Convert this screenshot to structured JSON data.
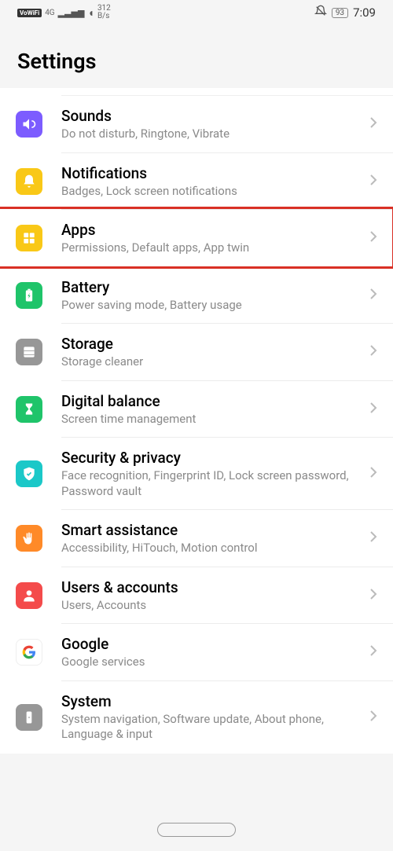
{
  "status": {
    "vowifi": "VoWiFi",
    "net": "4G",
    "speed_top": "312",
    "speed_bot": "B/s",
    "battery": "93",
    "time": "7:09"
  },
  "header": {
    "title": "Settings"
  },
  "items": [
    {
      "title": "Sounds",
      "subtitle": "Do not disturb, Ringtone, Vibrate"
    },
    {
      "title": "Notifications",
      "subtitle": "Badges, Lock screen notifications"
    },
    {
      "title": "Apps",
      "subtitle": "Permissions, Default apps, App twin"
    },
    {
      "title": "Battery",
      "subtitle": "Power saving mode, Battery usage"
    },
    {
      "title": "Storage",
      "subtitle": "Storage cleaner"
    },
    {
      "title": "Digital balance",
      "subtitle": "Screen time management"
    },
    {
      "title": "Security & privacy",
      "subtitle": "Face recognition, Fingerprint ID, Lock screen password, Password vault"
    },
    {
      "title": "Smart assistance",
      "subtitle": "Accessibility, HiTouch, Motion control"
    },
    {
      "title": "Users & accounts",
      "subtitle": "Users, Accounts"
    },
    {
      "title": "Google",
      "subtitle": "Google services"
    },
    {
      "title": "System",
      "subtitle": "System navigation, Software update, About phone, Language & input"
    }
  ],
  "highlighted_index": 2
}
